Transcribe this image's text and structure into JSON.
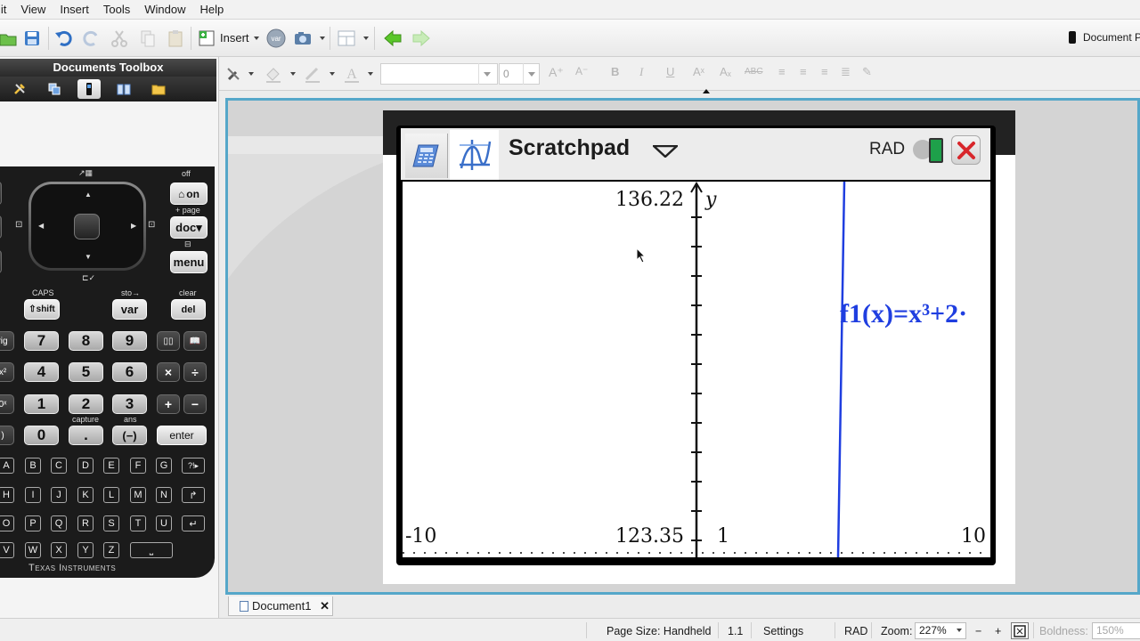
{
  "menu": {
    "items": [
      "lit",
      "View",
      "Insert",
      "Tools",
      "Window",
      "Help"
    ]
  },
  "toolbar": {
    "insert_label": "Insert",
    "document_props_label": "Document P",
    "var_label": "var"
  },
  "toolbox": {
    "title": "Documents Toolbox"
  },
  "format_bar": {
    "font_size_value": "0"
  },
  "keypad": {
    "off_label": "off",
    "on_label": "on",
    "page_label": "+ page",
    "doc_label": "doc",
    "menu_label": "menu",
    "caps_label": "CAPS",
    "shift_label": "shift",
    "sto_label": "sto→",
    "var_key_label": "var",
    "clear_label": "clear",
    "del_label": "del",
    "trig_label": "rig",
    "x2_label": "x²",
    "tenx_label": "0ˣ",
    "paren_label": ")",
    "capture_label": "capture",
    "ans_label": "ans",
    "enter_label": "enter",
    "neg_label": "(−)",
    "dot_label": ".",
    "times_label": "×",
    "divide_label": "÷",
    "plus_label": "+",
    "minus_label": "−",
    "digits": [
      "7",
      "8",
      "9",
      "4",
      "5",
      "6",
      "1",
      "2",
      "3",
      "0"
    ],
    "alpha_rows": [
      [
        "A",
        "B",
        "C",
        "D",
        "E",
        "F",
        "G",
        "?!▸"
      ],
      [
        "H",
        "I",
        "J",
        "K",
        "L",
        "M",
        "N",
        "↱"
      ],
      [
        "O",
        "P",
        "Q",
        "R",
        "S",
        "T",
        "U",
        "↵"
      ],
      [
        "V",
        "W",
        "X",
        "Y",
        "Z",
        "⎵"
      ]
    ],
    "logo": "Texas Instruments"
  },
  "handheld": {
    "app_title": "Scratchpad",
    "angle_mode": "RAD",
    "graph": {
      "ymax_label": "136.22",
      "ymin_label": "123.35",
      "xmin_label": "-10",
      "xscale_label": "1",
      "xmax_label": "10",
      "y_axis_label": "y",
      "function_label": "f1(x)=x³+2·"
    }
  },
  "document_tab": {
    "label": "Document1"
  },
  "status_bar": {
    "page_size": "Page Size: Handheld",
    "page_number": "1.1",
    "settings": "Settings",
    "angle": "RAD",
    "zoom_label": "Zoom:",
    "zoom_value": "227%",
    "minus": "−",
    "plus": "+",
    "boldness_label": "Boldness:",
    "boldness_value": "150%"
  },
  "colors": {
    "accent_border": "#55a7c9",
    "graph_blue": "#1f3ee0",
    "close_red": "#d8262b",
    "battery_green": "#1ea04a"
  }
}
